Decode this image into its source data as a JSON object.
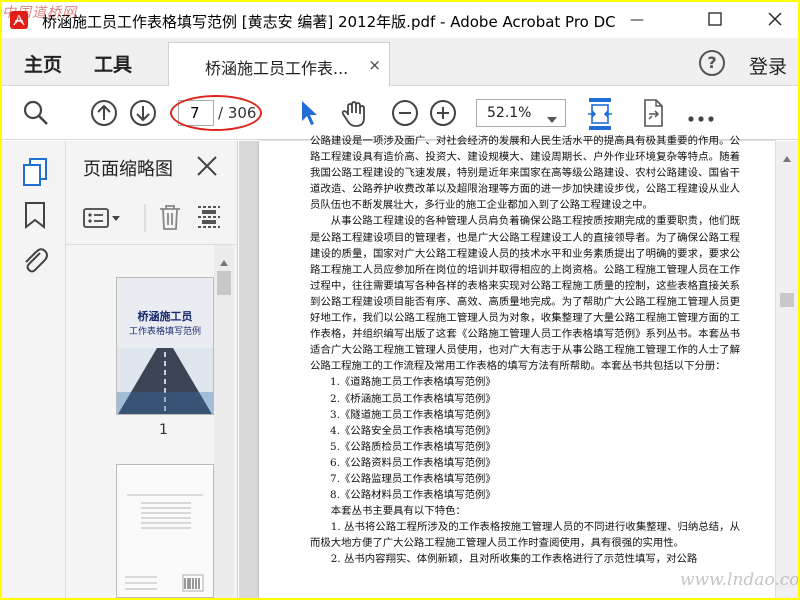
{
  "window": {
    "title": "桥涵施工员工作表格填写范例 [黄志安 编著] 2012年版.pdf - Adobe Acrobat Pro DC",
    "minimize_glyph": "—",
    "maximize_glyph": "☐",
    "close_glyph": "✕"
  },
  "watermarks": {
    "top_left": "中国道桥网",
    "bottom_right": "www.lndao.com"
  },
  "tabs": {
    "home": "主页",
    "tools": "工具",
    "document": "桥涵施工员工作表...",
    "document_close": "×",
    "help": "?",
    "login": "登录"
  },
  "toolbar": {
    "current_page": "7",
    "total_pages": "/ 306",
    "zoom": "52.1%"
  },
  "thumbnail_panel": {
    "title": "页面缩略图",
    "page1_label": "1",
    "cover_title": "桥涵施工员",
    "cover_subtitle": "工作表格填写范例"
  },
  "document": {
    "paragraphs": [
      {
        "style": "plain",
        "text": "公路建设是一项涉及面广、对社会经济的发展和人民生活水平的提高具有极其重要的作用。公路工程建设具有造价高、投资大、建设规模大、建设周期长、户外作业环境复杂等特点。随着我国公路工程建设的飞速发展，特别是近年来国家在高等级公路建设、农村公路建设、国省干道改造、公路养护收费改革以及超限治理等方面的进一步加快建设步伐，公路工程建设从业人员队伍也不断发展壮大，多行业的施工企业都加入到了公路工程建设之中。"
      },
      {
        "style": "indent",
        "text": "从事公路工程建设的各种管理人员肩负着确保公路工程按质按期完成的重要职责，他们既是公路工程建设项目的管理者，也是广大公路工程建设工人的直接领导者。为了确保公路工程建设的质量，国家对广大公路工程建设人员的技术水平和业务素质提出了明确的要求，要求公路工程施工人员应参加所在岗位的培训并取得相应的上岗资格。公路工程施工管理人员在工作过程中，往往需要填写各种各样的表格来实现对公路工程施工质量的控制，这些表格直接关系到公路工程建设项目能否有序、高效、高质量地完成。为了帮助广大公路工程施工管理人员更好地工作，我们以公路工程施工管理人员为对象，收集整理了大量公路工程施工管理方面的工作表格，并组织编写出版了这套《公路施工管理人员工作表格填写范例》系列丛书。本套丛书适合广大公路工程施工管理人员使用，也对广大有志于从事公路工程施工管理工作的人士了解公路工程施工的工作流程及常用工作表格的填写方法有所帮助。本套丛书共包括以下分册："
      },
      {
        "style": "list",
        "text": "1.《道路施工员工作表格填写范例》"
      },
      {
        "style": "list",
        "text": "2.《桥涵施工员工作表格填写范例》"
      },
      {
        "style": "list",
        "text": "3.《隧道施工员工作表格填写范例》"
      },
      {
        "style": "list",
        "text": "4.《公路安全员工作表格填写范例》"
      },
      {
        "style": "list",
        "text": "5.《公路质检员工作表格填写范例》"
      },
      {
        "style": "list",
        "text": "6.《公路资料员工作表格填写范例》"
      },
      {
        "style": "list",
        "text": "7.《公路监理员工作表格填写范例》"
      },
      {
        "style": "list",
        "text": "8.《公路材料员工作表格填写范例》"
      },
      {
        "style": "indent",
        "text": "本套丛书主要具有以下特色："
      },
      {
        "style": "indent",
        "text": "1. 丛书将公路工程所涉及的工作表格按施工管理人员的不同进行收集整理、归纳总结，从而极大地方便了广大公路工程施工管理人员工作时查阅使用，具有很强的实用性。"
      },
      {
        "style": "indent",
        "text": "2. 丛书内容翔实、体例新颖，且对所收集的工作表格进行了示范性填写，对公路"
      }
    ]
  }
}
